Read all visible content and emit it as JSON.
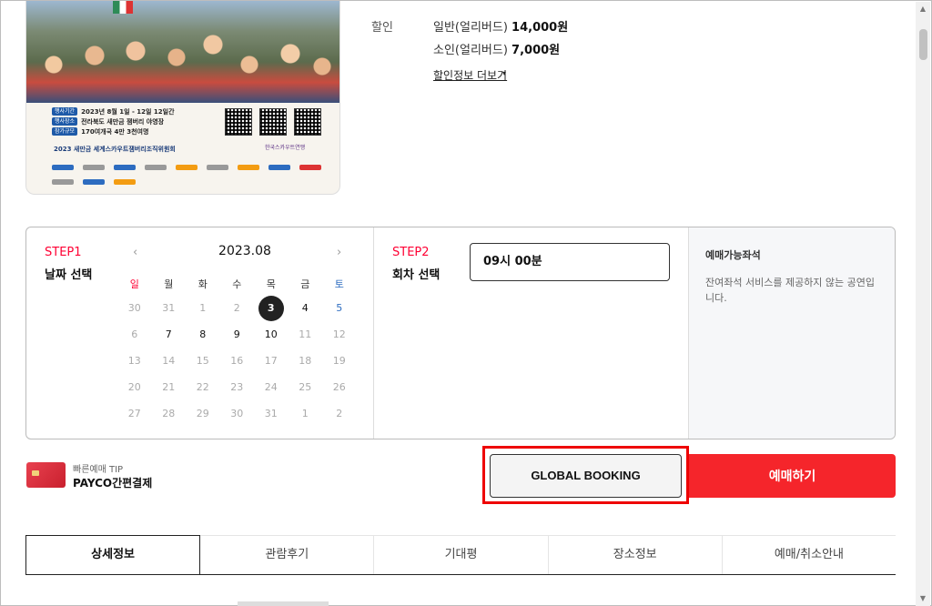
{
  "poster": {
    "info_rows": [
      {
        "tag": "행사기간",
        "value": "2023년 8월 1일 - 12일 12일간"
      },
      {
        "tag": "행사장소",
        "value": "전라북도 새만금 잼버리 야영장"
      },
      {
        "tag": "참가규모",
        "value": "170여개국 4만 3천여명"
      }
    ],
    "org_left": "2023 새만금 세계스카우트잼버리조직위원회",
    "org_right": "한국스카우트연맹"
  },
  "discount": {
    "label": "할인",
    "rows": [
      {
        "name": "일반(얼리버드)",
        "price": "14,000원"
      },
      {
        "name": "소인(얼리버드)",
        "price": "7,000원"
      }
    ],
    "more_link": "할인정보 더보기",
    "more_caret": "▾"
  },
  "step1": {
    "num": "STEP1",
    "title": "날짜 선택"
  },
  "calendar": {
    "prev": "‹",
    "next": "›",
    "title": "2023.08",
    "weekdays": [
      "일",
      "월",
      "화",
      "수",
      "목",
      "금",
      "토"
    ],
    "weeks": [
      [
        "30",
        "31",
        "1",
        "2",
        "3",
        "4",
        "5"
      ],
      [
        "6",
        "7",
        "8",
        "9",
        "10",
        "11",
        "12"
      ],
      [
        "13",
        "14",
        "15",
        "16",
        "17",
        "18",
        "19"
      ],
      [
        "20",
        "21",
        "22",
        "23",
        "24",
        "25",
        "26"
      ],
      [
        "27",
        "28",
        "29",
        "30",
        "31",
        "1",
        "2"
      ]
    ],
    "selected": "3"
  },
  "step2": {
    "num": "STEP2",
    "title": "회차 선택",
    "time": "09시 00분"
  },
  "seats": {
    "title": "예매가능좌석",
    "desc": "잔여좌석 서비스를 제공하지 않는 공연입니다."
  },
  "tip": {
    "small": "빠른예매 TIP",
    "big": "PAYCO간편결제"
  },
  "buttons": {
    "global": "GLOBAL BOOKING",
    "book": "예매하기"
  },
  "tabs": [
    "상세정보",
    "관람후기",
    "기대평",
    "장소정보",
    "예매/취소안내"
  ],
  "colors": {
    "accent": "#f5252b",
    "step": "#ff0033",
    "highlight": "#e00000"
  }
}
